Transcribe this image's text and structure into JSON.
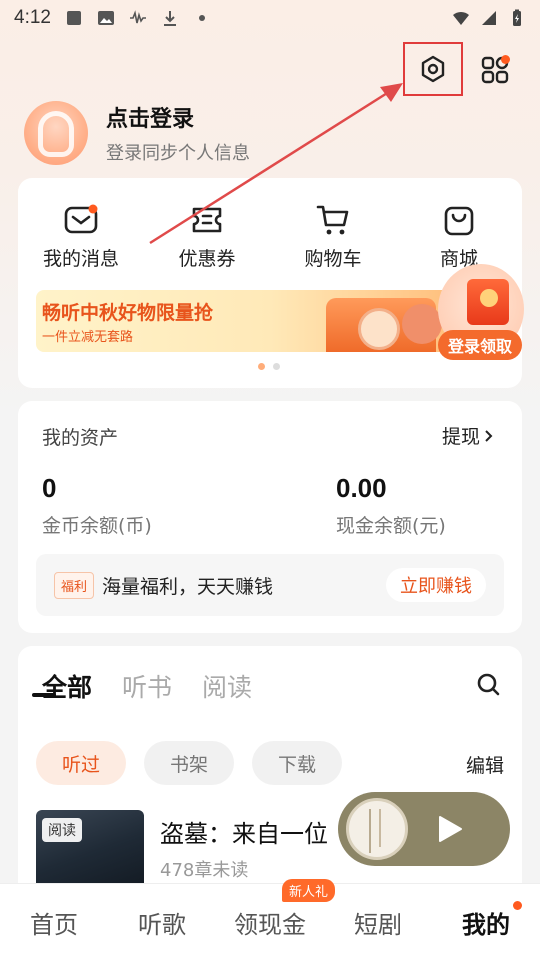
{
  "status_bar": {
    "time": "4:12"
  },
  "profile": {
    "title": "点击登录",
    "subtitle": "登录同步个人信息"
  },
  "quick_actions": [
    {
      "label": "我的消息",
      "icon": "mail-icon"
    },
    {
      "label": "优惠券",
      "icon": "coupon-icon"
    },
    {
      "label": "购物车",
      "icon": "cart-icon"
    },
    {
      "label": "商城",
      "icon": "shopping-bag-icon"
    }
  ],
  "banner": {
    "title": "畅听中秋好物限量抢",
    "subtitle": "一件立减无套路",
    "cta": "登录领取"
  },
  "assets": {
    "title": "我的资产",
    "withdraw": "提现",
    "coins_value": "0",
    "coins_label": "金币余额(币)",
    "cash_value": "0.00",
    "cash_label": "现金余额(元)",
    "welfare_badge": "福利",
    "welfare_text": "海量福利，天天赚钱",
    "welfare_button": "立即赚钱"
  },
  "library": {
    "tabs": [
      "全部",
      "听书",
      "阅读"
    ],
    "chips": [
      "听过",
      "书架",
      "下载"
    ],
    "edit": "编辑",
    "book": {
      "tag": "阅读",
      "title": "盗墓：来自一位",
      "progress": "478章未读"
    }
  },
  "bottom_nav": {
    "items": [
      "首页",
      "听歌",
      "领现金",
      "短剧",
      "我的"
    ],
    "badge": "新人礼"
  },
  "colors": {
    "accent": "#e8541c",
    "highlight_box": "#e03b3b"
  }
}
